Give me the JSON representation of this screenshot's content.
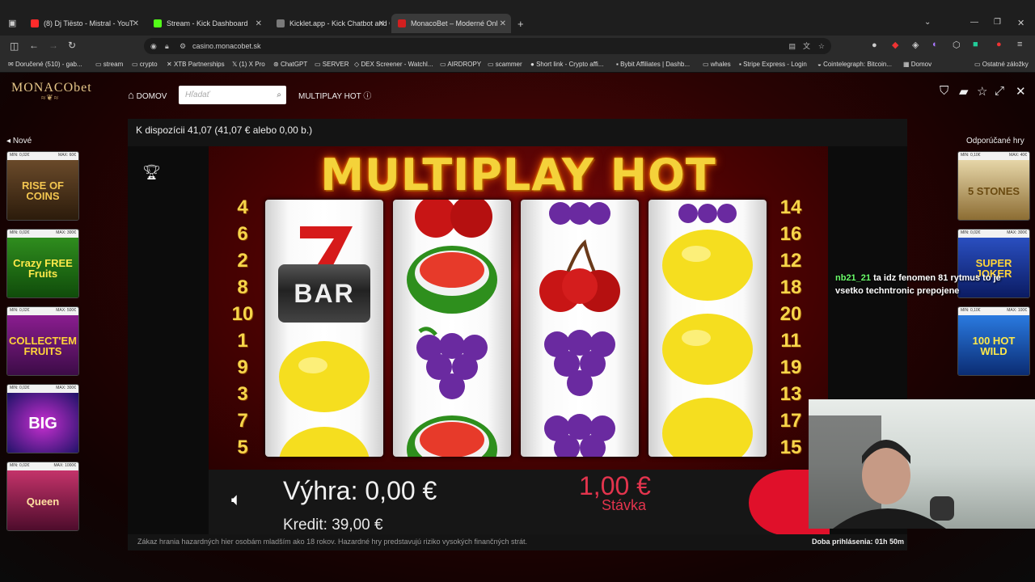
{
  "browser": {
    "tabs": [
      {
        "title": "(8) Dj Tiësto - Mistral - YouT",
        "color": "#ff2b2b"
      },
      {
        "title": "Stream - Kick Dashboard",
        "color": "#53fc18"
      },
      {
        "title": "Kicklet.app - Kick Chatbot and C",
        "color": "#7a7a7a"
      },
      {
        "title": "MonacoBet – Moderné Onl",
        "color": "#d21f1f"
      }
    ],
    "url": "casino.monacobet.sk",
    "bookmarks": [
      "Doručené (510) - gab...",
      "stream",
      "crypto",
      "XTB Partnerships",
      "(1) X Pro",
      "ChatGPT",
      "SERVER",
      "DEX Screener - Watchl...",
      "AIRDROPY",
      "scammer",
      "Short link - Crypto affi...",
      "Bybit Affiliates | Dashb...",
      "whales",
      "Stripe Express - Login",
      "Cointelegraph: Bitcoin...",
      "Domov",
      "Ostatné záložky"
    ]
  },
  "site": {
    "logo": "MONACObet",
    "nav": {
      "home": "DOMOV",
      "search_placeholder": "Hľadať",
      "game_title": "MULTIPLAY HOT"
    },
    "left_column": {
      "heading": "Nové",
      "games": [
        {
          "min": "MIN: 0,02€",
          "max": "MAX: 60€",
          "name": "RISE OF COINS"
        },
        {
          "min": "MIN: 0,02€",
          "max": "MAX: 300€",
          "name": "Crazy FREE Fruits"
        },
        {
          "min": "MIN: 0,02€",
          "max": "MAX: 500€",
          "name": "COLLECT'EM FRUITS"
        },
        {
          "min": "MIN: 0,02€",
          "max": "MAX: 300€",
          "name": "BIG"
        },
        {
          "min": "MIN: 0,02€",
          "max": "MAX: 1000€",
          "name": "Queen"
        }
      ]
    },
    "right_column": {
      "heading": "Odporúčané hry",
      "games": [
        {
          "min": "MIN: 0,10€",
          "max": "MAX: 40€",
          "name": "5 STONES"
        },
        {
          "min": "MIN: 0,02€",
          "max": "MAX: 300€",
          "name": "SUPER JOKER"
        },
        {
          "min": "MIN: 0,10€",
          "max": "MAX: 100€",
          "name": "100 HOT WILD"
        }
      ]
    },
    "balance_text": "K dispozícii 41,07 (41,07 € alebo 0,00 b.)",
    "game": {
      "title": "MULTIPLAY HOT",
      "left_lines": [
        "4",
        "6",
        "2",
        "8",
        "10",
        "1",
        "9",
        "3",
        "7",
        "5"
      ],
      "right_lines": [
        "14",
        "16",
        "12",
        "18",
        "20",
        "11",
        "19",
        "13",
        "17",
        "15"
      ],
      "reels": [
        [
          "seven",
          "bar",
          "lemon"
        ],
        [
          "melon",
          "grapes",
          "melon"
        ],
        [
          "cherry",
          "grapes",
          "grapes"
        ],
        [
          "lemon",
          "lemon",
          "lemon"
        ]
      ],
      "bar_label": "BAR",
      "win_label": "Výhra: 0,00 €",
      "credit_label": "Kredit: 39,00 €",
      "stake_value": "1,00 €",
      "stake_label": "Stávka"
    },
    "footer": {
      "warning": "Zákaz hrania hazardných hier osobám mladším ako 18 rokov. Hazardné hry predstavujú riziko vysokých finančných strát.",
      "login_time": "Doba prihlásenia: 01h 50m"
    }
  },
  "overlay": {
    "chat_user": "nb21_21",
    "chat_message": "ta idz fenomen 81 rytmus to je vsetko techntronic prepojene"
  },
  "colors": {
    "accent_gold": "#f4d23a",
    "stake_red": "#e3344d",
    "spin_red": "#e0102a"
  }
}
